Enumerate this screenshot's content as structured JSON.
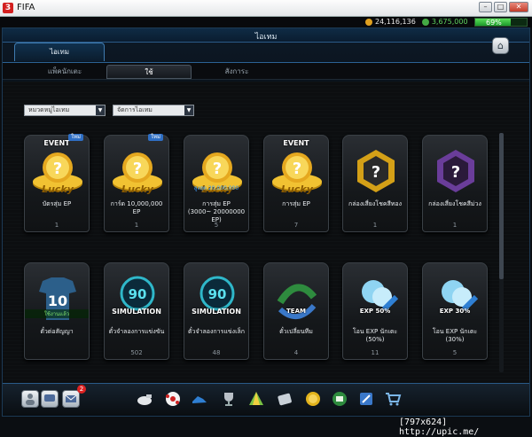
{
  "app": {
    "title": "FIFA",
    "logo": "3"
  },
  "status": {
    "coins": "24,116,136",
    "cash": "3,675,000",
    "percent": "69%",
    "percent_value": 0.69
  },
  "window": {
    "title": "ไอเทม"
  },
  "tabs": [
    {
      "label": "ไอเทม"
    }
  ],
  "subtabs": [
    {
      "label": "แพ็คนักเตะ"
    },
    {
      "label": "ใช้"
    },
    {
      "label": "สังการะ"
    }
  ],
  "filters": [
    {
      "value": "หมวดหมู่ไอเทม"
    },
    {
      "value": "จัดการไอเทม"
    }
  ],
  "items": [
    {
      "label": "บัตรสุ่ม EP",
      "count": "1",
      "icon": "lucky-coin-event-icon",
      "tag": "EVENT",
      "badge": "ใหม่"
    },
    {
      "label": "การ์ด 10,000,000 EP",
      "count": "1",
      "icon": "lucky-coin-icon",
      "tag": "",
      "badge": "ใหม่"
    },
    {
      "label": "การสุ่ม EP\n(3000~ 20000000 EP)",
      "count": "5",
      "icon": "lucky-coin-max-icon",
      "tag": "",
      "sub": "สูงสุด 20,000,000",
      "badge": ""
    },
    {
      "label": "การสุ่ม EP",
      "count": "7",
      "icon": "lucky-coin-event-icon",
      "tag": "EVENT",
      "badge": ""
    },
    {
      "label": "กล่องเสี่ยงโชคสีทอง",
      "count": "1",
      "icon": "gold-mystery-box-icon",
      "tag": "",
      "badge": ""
    },
    {
      "label": "กล่องเสี่ยงโชคสีม่วง",
      "count": "1",
      "icon": "purple-mystery-box-icon",
      "tag": "",
      "badge": ""
    },
    {
      "label": "ตั๋วต่อสัญญา",
      "count": "",
      "icon": "jersey-icon",
      "tag": "",
      "badge": "",
      "sub": "ใช้งานแล้ว"
    },
    {
      "label": "ตั๋วจำลองการแข่งขัน",
      "count": "502",
      "icon": "simulation-icon",
      "tag": "SIMULATION",
      "badge": ""
    },
    {
      "label": "ตั๋วจำลองการแข่งเล็ก",
      "count": "48",
      "icon": "simulation-icon",
      "tag": "SIMULATION",
      "badge": ""
    },
    {
      "label": "ตั๋วเปลี่ยนทีม",
      "count": "4",
      "icon": "team-change-icon",
      "tag": "TEAM",
      "badge": ""
    },
    {
      "label": "โอน EXP นักเตะ (50%)",
      "count": "11",
      "icon": "exp-transfer-icon",
      "tag": "EXP 50%",
      "badge": ""
    },
    {
      "label": "โอน EXP นักเตะ (30%)",
      "count": "5",
      "icon": "exp-transfer-icon",
      "tag": "EXP 30%",
      "badge": ""
    }
  ],
  "bottom": {
    "mail_badge": "2"
  },
  "watermark": "[797x624] http://upic.me/"
}
